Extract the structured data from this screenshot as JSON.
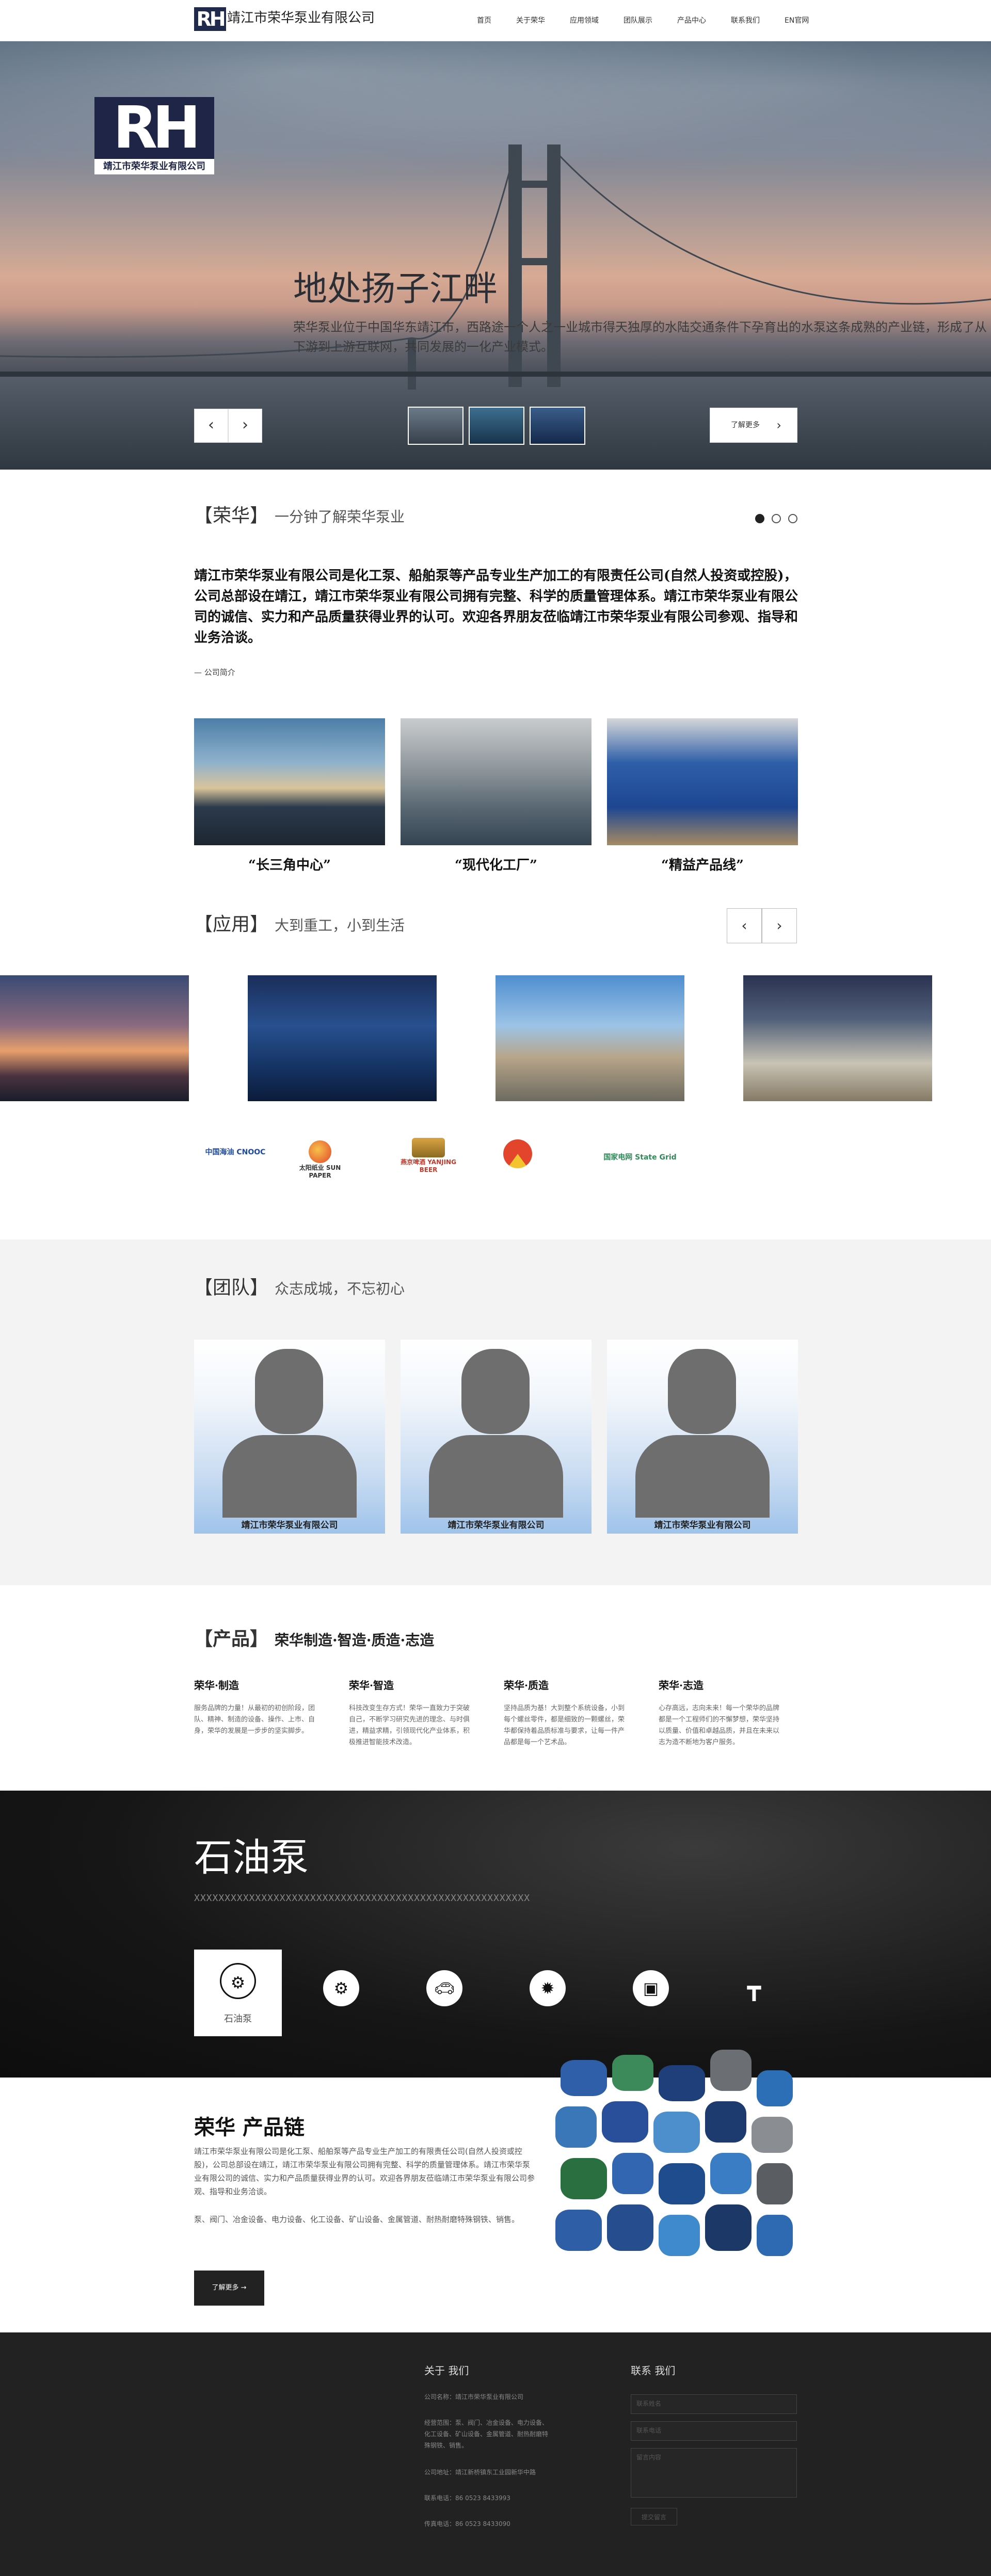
{
  "nav": {
    "logo_mark": "RH",
    "company": "靖江市荣华泵业有限公司",
    "menu": [
      "首页",
      "关于荣华",
      "应用领域",
      "团队展示",
      "产品中心",
      "联系我们",
      "EN官网"
    ]
  },
  "hero": {
    "logo_mark": "RH",
    "logo_caption": "靖江市荣华泵业有限公司",
    "title": "地处扬子江畔",
    "desc": "荣华泵业位于中国华东靖江市，西路途一个人之一业城市得天独厚的水陆交通条件下孕育出的水泵这条成熟的产业链，形成了从下游到上游互联网，共同发展的一化产业模式。",
    "prev": "‹",
    "next": "›",
    "learn_more": "了解更多",
    "learn_arrow": "›"
  },
  "about": {
    "bracket_title": "【荣华】",
    "subtitle": "一分钟了解荣华泵业",
    "intro": "靖江市荣华泵业有限公司是化工泵、船舶泵等产品专业生产加工的有限责任公司(自然人投资或控股)，公司总部设在靖江，靖江市荣华泵业有限公司拥有完整、科学的质量管理体系。靖江市荣华泵业有限公司的诚信、实力和产品质量获得业界的认可。欢迎各界朋友莅临靖江市荣华泵业有限公司参观、指导和业务洽谈。",
    "more_link": "— 公司简介",
    "captions": [
      "“长三角中心”",
      "“现代化工厂”",
      "“精益产品线”"
    ]
  },
  "apps": {
    "bracket_title": "【应用】",
    "subtitle": "大到重工，小到生活",
    "prev": "‹",
    "next": "›",
    "brands": [
      "中国海油 CNOOC",
      "太阳纸业 SUN PAPER",
      "燕京啤酒 YANJING BEER",
      "",
      "国家电网 State Grid"
    ]
  },
  "team": {
    "bracket_title": "【团队】",
    "subtitle": "众志成城，不忘初心",
    "members": [
      "靖江市荣华泵业有限公司",
      "靖江市荣华泵业有限公司",
      "靖江市荣华泵业有限公司"
    ]
  },
  "products": {
    "bracket_title": "【产品】",
    "subtitle": "荣华制造·智造·质造·志造",
    "cols": [
      {
        "h": "荣华·制造",
        "p": "服务品牌的力量！从最初的初创阶段，团队、精神、制造的设备、操作、上市、自身，荣华的发展是一步步的坚实脚步。"
      },
      {
        "h": "荣华·智造",
        "p": "科技改变生存方式！荣华一直致力于突破自己，不断学习研究先进的理念、与时俱进，精益求精，引领现代化产业体系，积极推进智能技术改造。"
      },
      {
        "h": "荣华·质造",
        "p": "坚持品质为基！大到整个系统设备，小到每个螺丝零件，都是细致的一颗螺丝，荣华都保持着品质标准与要求，让每一件产品都是每一个艺术品。"
      },
      {
        "h": "荣华·志造",
        "p": "心存高远，志向未来！每一个荣华的品牌都是一个工程师们的不懈梦想，荣华坚持以质量、价值和卓越品质，并且在未来以志为造不断地为客户服务。"
      }
    ]
  },
  "showcase": {
    "title": "石油泵",
    "x_line": "XXXXXXXXXXXXXXXXXXXXXXXXXXXXXXXXXXXXXXXXXXXXXXXXXXXXXXX",
    "selected_label": "石油泵",
    "icons": [
      "pump-icon",
      "gear-icon",
      "car-icon",
      "fire-icon",
      "drum-icon",
      "valve-icon"
    ]
  },
  "chain": {
    "title": "荣华 产品链",
    "p1": "靖江市荣华泵业有限公司是化工泵、船舶泵等产品专业生产加工的有限责任公司(自然人投资或控股)，公司总部设在靖江，靖江市荣华泵业有限公司拥有完整、科学的质量管理体系。靖江市荣华泵业有限公司的诚信、实力和产品质量获得业界的认可。欢迎各界朋友莅临靖江市荣华泵业有限公司参观、指导和业务洽谈。",
    "p2": "泵、阀门、冶金设备、电力设备、化工设备、矿山设备、金属管道、耐热耐磨特殊钢铁、销售。",
    "btn": "了解更多 →"
  },
  "footer": {
    "about_h": "关于 我们",
    "lines": [
      "公司名称：靖江市荣华泵业有限公司",
      "经营范围：泵、阀门、冶金设备、电力设备、化工设备、矿山设备、金属管道、耐热耐磨特殊钢铁、销售。",
      "公司地址：靖江新桥镇东工业园新华中路",
      "联系电话：86 0523 8433993",
      "传真电话：86 0523 8433090"
    ],
    "contact_h": "联系 我们",
    "fields": [
      "联系姓名",
      "联系电话",
      "留言内容"
    ],
    "submit": "提交留言"
  }
}
